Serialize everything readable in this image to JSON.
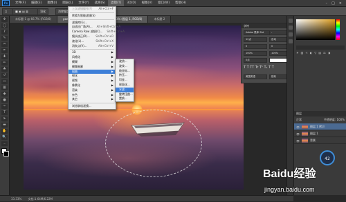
{
  "menubar": {
    "logo": "Ps",
    "items": [
      "文件(F)",
      "编辑(E)",
      "图像(I)",
      "图层(L)",
      "文字(Y)",
      "选择(S)",
      "滤镜(T)",
      "3D(D)",
      "视图(V)",
      "窗口(W)",
      "帮助(H)"
    ],
    "active_index": 6
  },
  "options": {
    "items": [
      "羽化",
      "消除锯齿"
    ]
  },
  "tabs": [
    {
      "label": "未标题-1 @ 66.7% (RGB/8)"
    },
    {
      "label": "paddle-nature-relax-137348.jpg @ 33.3% (图层 1, RGB/8)"
    },
    {
      "label": "未标题-2"
    }
  ],
  "filter_menu": {
    "rows": [
      {
        "label": "上次滤镜操作(F)",
        "shortcut": "Alt+Ctrl+F",
        "state": "disabled"
      },
      {
        "sep": true
      },
      {
        "label": "转换为智能滤镜(S)",
        "shortcut": "",
        "state": ""
      },
      {
        "sep": true
      },
      {
        "label": "滤镜库(G)...",
        "shortcut": "",
        "state": ""
      },
      {
        "label": "自适应广角(A)...",
        "shortcut": "Alt+Shift+Ctrl+A",
        "state": ""
      },
      {
        "label": "Camera Raw 滤镜(C)...",
        "shortcut": "Shift+Ctrl+A",
        "state": ""
      },
      {
        "label": "镜头校正(R)...",
        "shortcut": "Shift+Ctrl+R",
        "state": ""
      },
      {
        "label": "液化(L)...",
        "shortcut": "Shift+Ctrl+X",
        "state": ""
      },
      {
        "label": "消失点(V)...",
        "shortcut": "Alt+Ctrl+V",
        "state": ""
      },
      {
        "sep": true
      },
      {
        "label": "3D",
        "shortcut": "",
        "state": "",
        "sub": true
      },
      {
        "label": "风格化",
        "shortcut": "",
        "state": "",
        "sub": true
      },
      {
        "label": "模糊",
        "shortcut": "",
        "state": "",
        "sub": true
      },
      {
        "label": "模糊画廊",
        "shortcut": "",
        "state": "",
        "sub": true
      },
      {
        "label": "扭曲",
        "shortcut": "",
        "state": "hl",
        "sub": true
      },
      {
        "label": "锐化",
        "shortcut": "",
        "state": "",
        "sub": true
      },
      {
        "label": "视频",
        "shortcut": "",
        "state": "",
        "sub": true
      },
      {
        "label": "像素化",
        "shortcut": "",
        "state": "",
        "sub": true
      },
      {
        "label": "渲染",
        "shortcut": "",
        "state": "",
        "sub": true
      },
      {
        "label": "杂色",
        "shortcut": "",
        "state": "",
        "sub": true
      },
      {
        "label": "其它",
        "shortcut": "",
        "state": "",
        "sub": true
      },
      {
        "sep": true
      },
      {
        "label": "浏览联机滤镜...",
        "shortcut": "",
        "state": ""
      }
    ]
  },
  "distort_submenu": {
    "rows": [
      {
        "label": "波浪...",
        "state": ""
      },
      {
        "label": "波纹...",
        "state": ""
      },
      {
        "label": "极坐标...",
        "state": ""
      },
      {
        "label": "挤压...",
        "state": ""
      },
      {
        "label": "切变...",
        "state": ""
      },
      {
        "label": "球面化...",
        "state": ""
      },
      {
        "label": "水波...",
        "state": "hl"
      },
      {
        "label": "旋转扭曲...",
        "state": ""
      },
      {
        "label": "置换...",
        "state": ""
      }
    ]
  },
  "char_panel": {
    "title": "字符",
    "font": "Adobe 黑体 Std",
    "size": "12点",
    "leading": "自动",
    "tracking": "0",
    "scale_v": "100%",
    "scale_h": "100%",
    "baseline": "0点",
    "lang": "美国英语",
    "aa": "锐利"
  },
  "layers_panel": {
    "title": "图层",
    "mode": "正常",
    "opacity_label": "不透明度: 100%",
    "layers": [
      {
        "name": "图层 1 拷贝",
        "selected": true
      },
      {
        "name": "图层 1",
        "selected": false
      },
      {
        "name": "背景",
        "selected": false
      }
    ]
  },
  "status": {
    "zoom": "33.33%",
    "doc": "文档:1.64M/6.22M"
  },
  "zoom_badge": "42",
  "watermark": {
    "brand": "Baidu经验",
    "url": "jingyan.baidu.com"
  }
}
